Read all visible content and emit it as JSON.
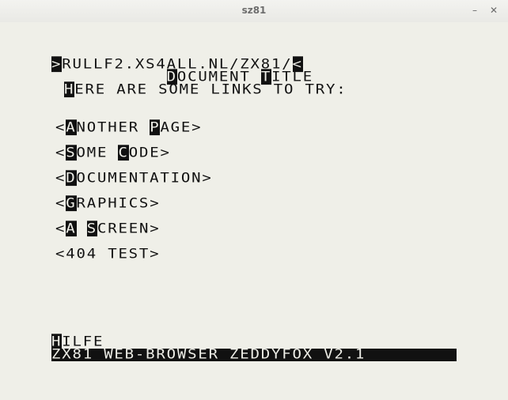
{
  "window": {
    "title": "sz81",
    "minimize": "–",
    "close": "✕"
  },
  "header": {
    "url_open": ">",
    "url": "RULLF2.XS4ALL.NL/ZX81/",
    "url_close": "<",
    "title_prefix": "           ",
    "title_D": "D",
    "title_mid": "OCUMENT ",
    "title_T": "T",
    "title_rest": "ITLE",
    "intro_H": "H",
    "intro_rest": "ERE ARE SOME LINKS TO TRY:"
  },
  "links": [
    {
      "open": "<",
      "k1": "A",
      "r1": "NOTHER ",
      "k2": "P",
      "r2": "AGE",
      "close": ">"
    },
    {
      "open": "<",
      "k1": "S",
      "r1": "OME ",
      "k2": "C",
      "r2": "ODE",
      "close": ">"
    },
    {
      "open": "<",
      "k1": "D",
      "r1": "OCUMENTATION",
      "k2": "",
      "r2": "",
      "close": ">"
    },
    {
      "open": "<",
      "k1": "G",
      "r1": "RAPHICS",
      "k2": "",
      "r2": "",
      "close": ">"
    },
    {
      "open": "<",
      "k1": "A",
      "r1": " ",
      "k2": "S",
      "r2": "CREEN",
      "close": ">"
    },
    {
      "open": "<",
      "k1": "",
      "r1": "404 TEST",
      "k2": "",
      "r2": "",
      "close": ">"
    }
  ],
  "footer": {
    "help_H": "H",
    "help_rest": "ILFE",
    "status": "ZX81 WEB-BROWSER ZEDDYFOX V2.1"
  },
  "colors": {
    "ink": "#111111",
    "paper": "#efefe8"
  }
}
